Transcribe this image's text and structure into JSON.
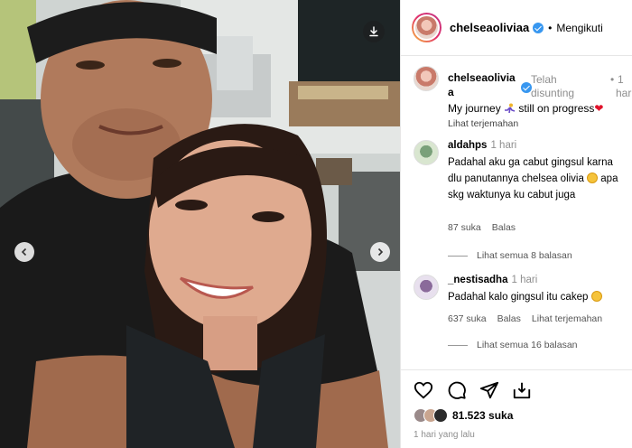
{
  "post": {
    "username": "chelseaoliviaa",
    "follow_status": "Mengikuti",
    "dot": "•"
  },
  "caption": {
    "username": "chelseaolivia a",
    "status": "Telah disunting",
    "dot": "•",
    "days": "1",
    "days_unit": "hari",
    "text": "My journey ",
    "text_after_emoji": " still on progress",
    "translate": "Lihat terjemahan"
  },
  "comments": [
    {
      "username": "aldahps",
      "time": "1 hari",
      "text": "Padahal aku ga cabut gingsul karna dlu panutannya chelsea olivia ",
      "text_after_emoji": " apa skg waktunya ku cabut juga",
      "likes": "87 suka",
      "reply": "Balas",
      "view_replies": "Lihat semua 8 balasan"
    },
    {
      "username": "_nestisadha",
      "time": "1 hari",
      "text": "Padahal kalo gingsul itu cakep",
      "likes": "637 suka",
      "reply": "Balas",
      "translate": "Lihat terjemahan",
      "view_replies": "Lihat semua 16 balasan"
    }
  ],
  "actions": {
    "icons": [
      "heart-icon",
      "comment-icon",
      "share-icon",
      "save-icon"
    ],
    "likes_count": "81.523 suka",
    "time_ago": "1 hari yang lalu"
  },
  "colors": {
    "verified": "#3897f0",
    "heart": "#e0132b",
    "muted_text": "#8e8e8e"
  }
}
